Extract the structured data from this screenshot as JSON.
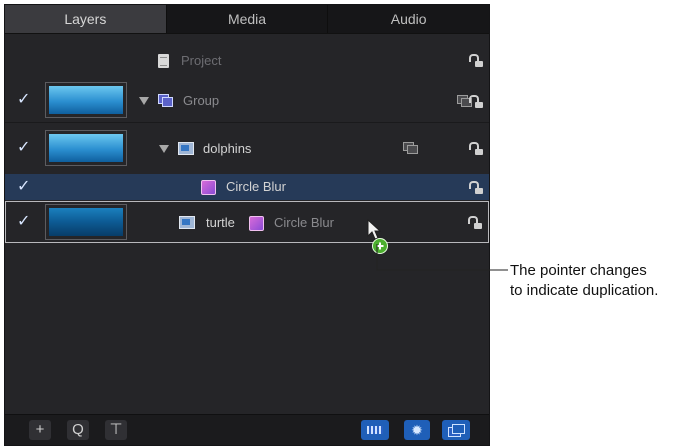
{
  "tabs": [
    "Layers",
    "Media",
    "Audio"
  ],
  "rows": {
    "project": {
      "label": "Project"
    },
    "group": {
      "label": "Group"
    },
    "dolphins": {
      "label": "dolphins"
    },
    "circle_blur": {
      "label": "Circle Blur"
    },
    "turtle": {
      "label": "turtle",
      "filter_label": "Circle Blur"
    }
  },
  "toolbar": {
    "add": "+",
    "search": "Q",
    "toolbar_third": "⊤"
  },
  "callout": {
    "line1": "The pointer changes",
    "line2": "to indicate duplication."
  },
  "colors": {
    "accent": "#2b61c4",
    "green_plus": "#4caf2f",
    "selection": "#263a58"
  }
}
